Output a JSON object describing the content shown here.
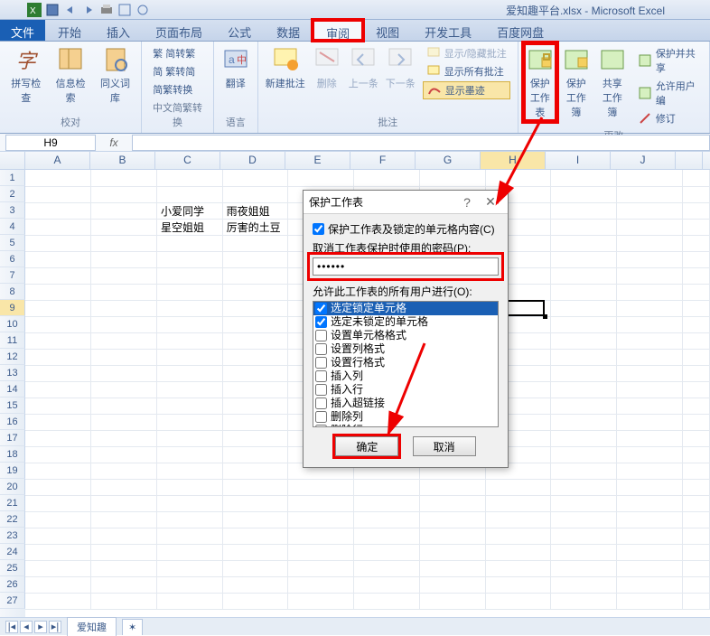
{
  "app_title": "爱知趣平台.xlsx - Microsoft Excel",
  "tabs": {
    "file": "文件",
    "home": "开始",
    "insert": "插入",
    "layout": "页面布局",
    "formulas": "公式",
    "data": "数据",
    "review": "审阅",
    "view": "视图",
    "dev": "开发工具",
    "baidu": "百度网盘"
  },
  "ribbon": {
    "proof": {
      "spell": "拼写检查",
      "research": "信息检索",
      "thesaurus": "同义词库",
      "label": "校对"
    },
    "cnconv": {
      "s2t": "繁 简转繁",
      "t2s": "简 繁转简",
      "conv": "简繁转换",
      "label": "中文简繁转换"
    },
    "lang": {
      "translate": "翻译",
      "label": "语言"
    },
    "comments": {
      "new": "新建批注",
      "delete": "删除",
      "prev": "上一条",
      "next": "下一条",
      "showhide": "显示/隐藏批注",
      "showall": "显示所有批注",
      "ink": "显示墨迹",
      "label": "批注"
    },
    "changes": {
      "protect_sheet": "保护\n工作表",
      "protect_wb": "保护\n工作簿",
      "share": "共享\n工作簿",
      "protshare": "保护并共享",
      "allowedit": "允许用户编",
      "track": "修订",
      "label": "更改"
    }
  },
  "namebox": "H9",
  "fx": "fx",
  "cols": [
    "A",
    "B",
    "C",
    "D",
    "E",
    "F",
    "G",
    "H",
    "I",
    "J",
    ""
  ],
  "rows": [
    "1",
    "2",
    "3",
    "4",
    "5",
    "6",
    "7",
    "8",
    "9",
    "10",
    "11",
    "12",
    "13",
    "14",
    "15",
    "16",
    "17",
    "18",
    "19",
    "20",
    "21",
    "22",
    "23",
    "24",
    "25",
    "26",
    "27"
  ],
  "cells": {
    "C3": "小爱同学",
    "C4": "星空姐姐",
    "D3": "雨夜姐姐",
    "D4": "厉害的土豆"
  },
  "dialog": {
    "title": "保护工作表",
    "protect_content": "保护工作表及锁定的单元格内容(C)",
    "pwd_label": "取消工作表保护时使用的密码(P):",
    "pwd_value": "******",
    "perm_label": "允许此工作表的所有用户进行(O):",
    "perms": [
      "选定锁定单元格",
      "选定未锁定的单元格",
      "设置单元格格式",
      "设置列格式",
      "设置行格式",
      "插入列",
      "插入行",
      "插入超链接",
      "删除列",
      "删除行"
    ],
    "checked": [
      true,
      true,
      false,
      false,
      false,
      false,
      false,
      false,
      false,
      false
    ],
    "ok": "确定",
    "cancel": "取消"
  },
  "sheet": {
    "name": "爱知趣"
  }
}
